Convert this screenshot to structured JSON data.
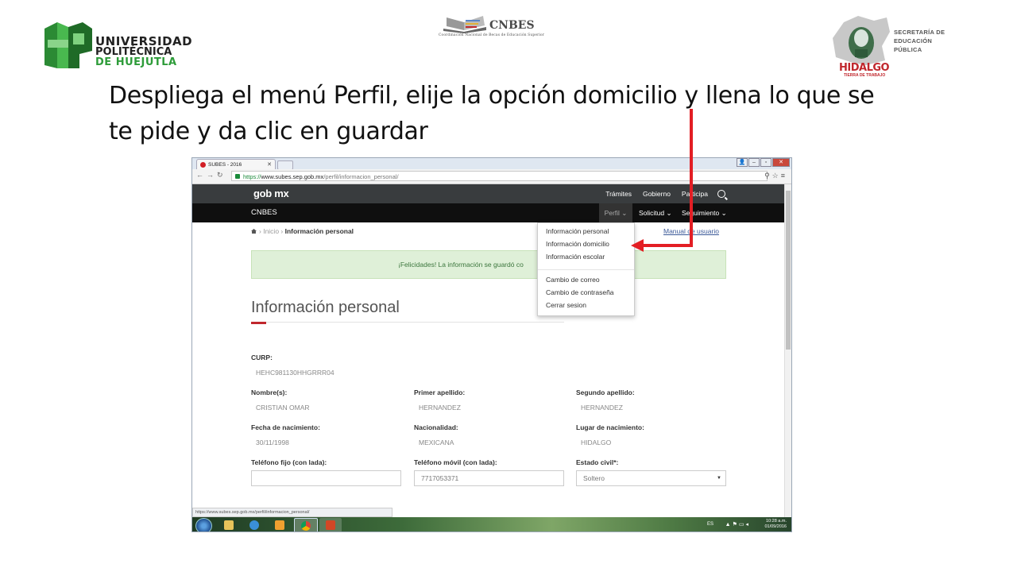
{
  "slide": {
    "instruction": "Despliega el menú Perfil, elije la opción domicilio y llena lo que se te pide y da clic en guardar"
  },
  "logos": {
    "uph": {
      "line1": "UNIVERSIDAD",
      "line2": "POLITÉCNICA",
      "line3": "DE HUEJUTLA"
    },
    "cnbes": {
      "name": "CNBES",
      "subtitle": "Coordinación Nacional de Becas de Educación Superior"
    },
    "sep": {
      "line1": "SECRETARÍA DE",
      "line2": "EDUCACIÓN",
      "line3": "PÚBLICA",
      "state": "HIDALGO",
      "state_sub": "TIERRA DE TRABAJO"
    }
  },
  "browser": {
    "tab_title": "SUBES - 2016",
    "url_scheme": "https://",
    "url_host": "www.subes.sep.gob.mx",
    "url_path": "/perfil/informacion_personal/",
    "status_url": "https://www.subes.sep.gob.mx/perfil/informacion_personal/"
  },
  "gob_nav": {
    "logo": "gob mx",
    "links": [
      "Trámites",
      "Gobierno",
      "Participa"
    ]
  },
  "site_nav": {
    "brand": "CNBES",
    "perfil": "Perfil ⌄",
    "solicitud": "Solicitud ⌄",
    "seguimiento": "Seguimiento ⌄"
  },
  "breadcrumb": {
    "home": "Inicio",
    "current": "Información personal",
    "manual": "Manual de usuario"
  },
  "alert": {
    "text": "¡Felicidades! La información se guardó co"
  },
  "section": {
    "title": "Información personal"
  },
  "fields": {
    "curp": {
      "label": "CURP:",
      "value": "HEHC981130HHGRRR04"
    },
    "nombre": {
      "label": "Nombre(s):",
      "value": "CRISTIAN OMAR"
    },
    "primer_apellido": {
      "label": "Primer apellido:",
      "value": "HERNANDEZ"
    },
    "segundo_apellido": {
      "label": "Segundo apellido:",
      "value": "HERNANDEZ"
    },
    "fecha_nacimiento": {
      "label": "Fecha de nacimiento:",
      "value": "30/11/1998"
    },
    "nacionalidad": {
      "label": "Nacionalidad:",
      "value": "MEXICANA"
    },
    "lugar_nacimiento": {
      "label": "Lugar de nacimiento:",
      "value": "HIDALGO"
    },
    "telefono_fijo": {
      "label": "Teléfono fijo (con lada):",
      "value": ""
    },
    "telefono_movil": {
      "label": "Teléfono móvil (con lada):",
      "value": "7717053371"
    },
    "estado_civil": {
      "label": "Estado civil*:",
      "value": "Soltero"
    }
  },
  "perfil_menu": {
    "items": [
      "Información personal",
      "Información domicilio",
      "Información escolar"
    ],
    "items2": [
      "Cambio de correo",
      "Cambio de contraseña",
      "Cerrar sesion"
    ]
  },
  "taskbar": {
    "lang": "ES",
    "time": "10:28 a.m.",
    "date": "01/09/2016"
  },
  "colors": {
    "accent_red": "#e31e24",
    "gob_bar": "#393c3e",
    "nav_bar": "#0f0f0f",
    "alert_bg": "#dff0d8"
  }
}
